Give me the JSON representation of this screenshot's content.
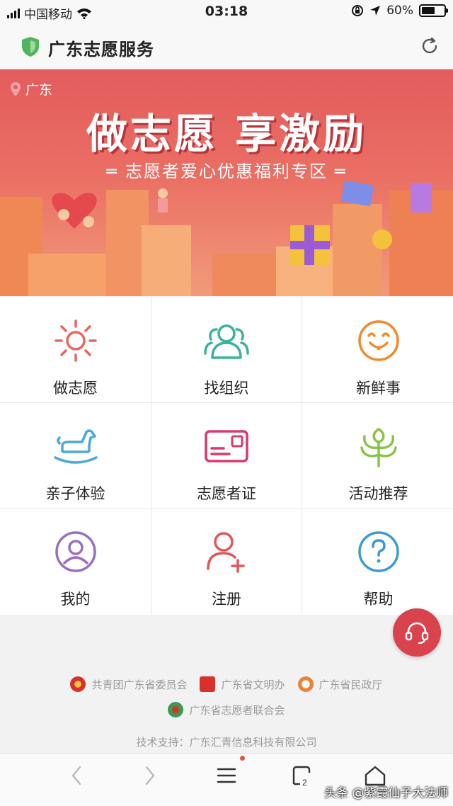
{
  "status_bar": {
    "carrier": "中国移动",
    "time": "03:18",
    "battery": "60%"
  },
  "header": {
    "title": "广东志愿服务"
  },
  "banner": {
    "location": "广东",
    "headline": "做志愿 享激励",
    "subtitle": "志愿者爱心优惠福利专区"
  },
  "grid": [
    {
      "label": "做志愿",
      "icon": "sun-icon",
      "color": "#e8675e"
    },
    {
      "label": "找组织",
      "icon": "group-icon",
      "color": "#3bb39b"
    },
    {
      "label": "新鲜事",
      "icon": "smiley-icon",
      "color": "#ef8a2d"
    },
    {
      "label": "亲子体验",
      "icon": "rocking-horse-icon",
      "color": "#49a8dd"
    },
    {
      "label": "志愿者证",
      "icon": "id-card-icon",
      "color": "#d83a6a"
    },
    {
      "label": "活动推荐",
      "icon": "tree-icon",
      "color": "#8bc34a"
    },
    {
      "label": "我的",
      "icon": "user-circle-icon",
      "color": "#9a6fc2"
    },
    {
      "label": "注册",
      "icon": "add-user-icon",
      "color": "#e25757"
    },
    {
      "label": "帮助",
      "icon": "question-icon",
      "color": "#3b9bd2"
    }
  ],
  "sponsors": [
    "共青团广东省委员会",
    "广东省文明办",
    "广东省民政厅",
    "广东省志愿者联合会"
  ],
  "tech_support": "技术支持：广东汇青信息科技有限公司",
  "watermark": "头条 @紫霞仙子大法师"
}
